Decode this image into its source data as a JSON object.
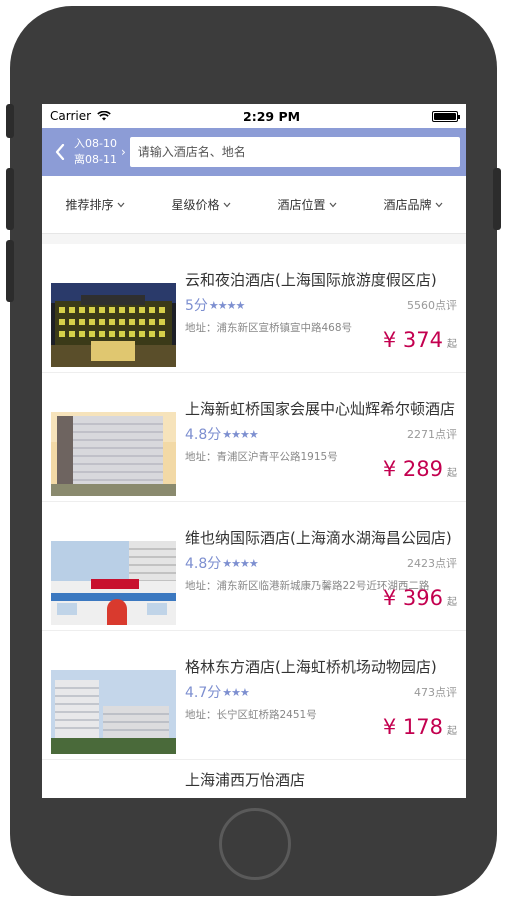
{
  "status": {
    "carrier": "Carrier",
    "time": "2:29 PM"
  },
  "header": {
    "checkin": "入08-10",
    "checkout": "离08-11",
    "search_placeholder": "请输入酒店名、地名"
  },
  "filters": [
    {
      "label": "推荐排序"
    },
    {
      "label": "星级价格"
    },
    {
      "label": "酒店位置"
    },
    {
      "label": "酒店品牌"
    }
  ],
  "hotels": [
    {
      "name": "云和夜泊酒店(上海国际旅游度假区店)",
      "score": "5分",
      "stars": "★★★★",
      "reviews": "5560点评",
      "address": "地址：浦东新区宣桥镇宣中路468号",
      "price": "¥ 374",
      "suffix": "起"
    },
    {
      "name": "上海新虹桥国家会展中心灿辉希尔顿酒店",
      "score": "4.8分",
      "stars": "★★★★",
      "reviews": "2271点评",
      "address": "地址：青浦区沪青平公路1915号",
      "price": "¥ 289",
      "suffix": "起"
    },
    {
      "name": "维也纳国际酒店(上海滴水湖海昌公园店)",
      "score": "4.8分",
      "stars": "★★★★",
      "reviews": "2423点评",
      "address": "地址：浦东新区临港新城康乃馨路22号近环湖西二路",
      "price": "¥ 396",
      "suffix": "起"
    },
    {
      "name": "格林东方酒店(上海虹桥机场动物园店)",
      "score": "4.7分",
      "stars": "★★★",
      "reviews": "473点评",
      "address": "地址：长宁区虹桥路2451号",
      "price": "¥ 178",
      "suffix": "起"
    },
    {
      "name": "上海浦西万怡酒店"
    }
  ]
}
